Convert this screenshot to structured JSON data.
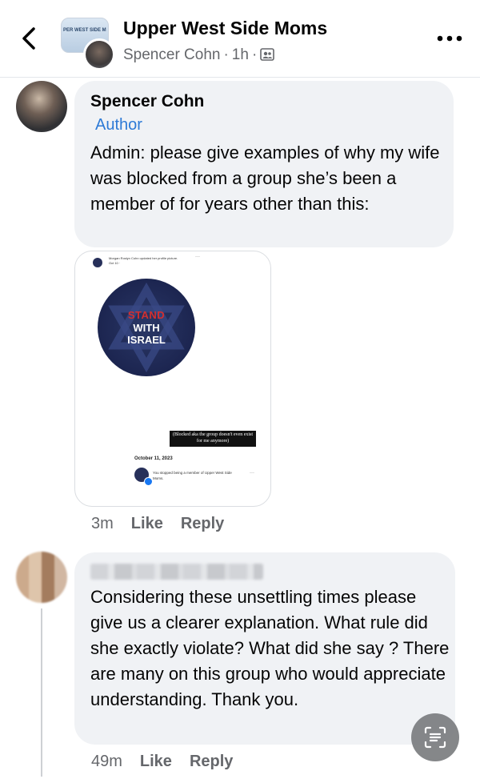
{
  "header": {
    "group_name": "Upper West Side Moms",
    "author": "Spencer Cohn",
    "time": "1h",
    "separator": "·",
    "group_cover_text": "PER WEST SIDE M"
  },
  "comments": [
    {
      "author": "Spencer Cohn",
      "badge": "Author",
      "text": "Admin: please give examples of why my wife was blocked from a group she’s been a member of for years other than this:",
      "time": "3m",
      "like_label": "Like",
      "reply_label": "Reply",
      "attachment": {
        "header_text": "Morgan Roslyn Cohn updated her profile picture.",
        "header_sub": "Oct 10 · ",
        "more": "···",
        "image_text": [
          "STAND",
          "WITH",
          "ISRAEL"
        ],
        "caption": "(Blocked aka the group doesn't even exist for me anymore)",
        "date": "October 11, 2023",
        "notice": "You stopped being a member of Upper West Side Moms.",
        "notice_more": "···"
      }
    },
    {
      "author": "",
      "text": "Considering these unsettling times please give us a clearer explanation. What rule did she exactly violate?  What did she say ?  There are many on this group who would appreciate understanding. Thank you.",
      "time": "49m",
      "like_label": "Like",
      "reply_label": "Reply"
    }
  ],
  "icons": {
    "back": "chevron-left-icon",
    "more": "more-horizontal-icon",
    "group_badge": "group-icon",
    "fab": "text-scan-icon"
  },
  "colors": {
    "link_blue": "#2d7ad6",
    "bubble_bg": "#f0f2f5",
    "meta_gray": "#65676b"
  }
}
